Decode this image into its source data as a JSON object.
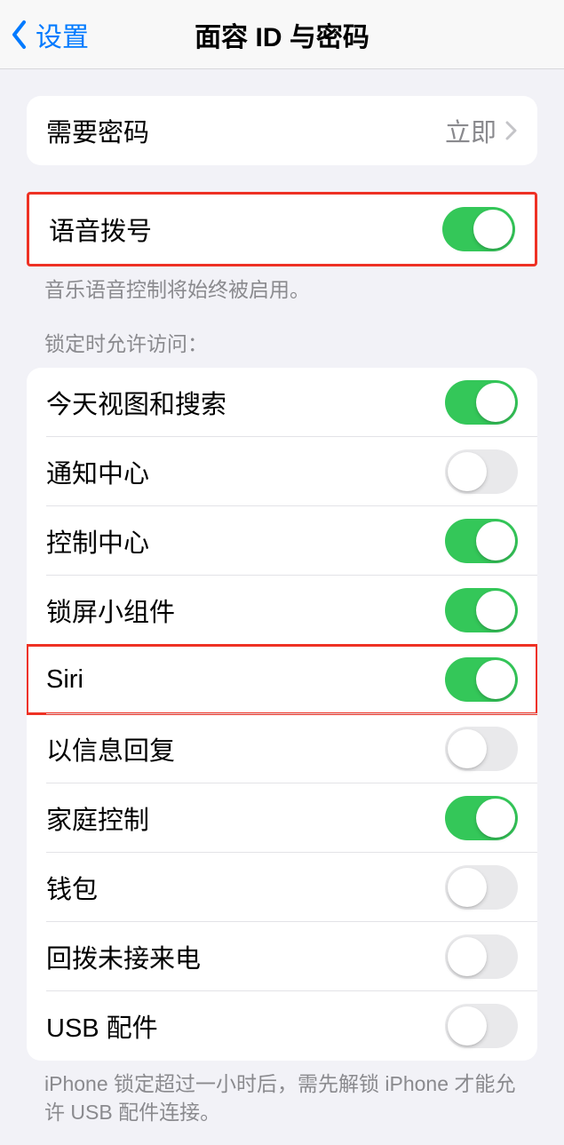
{
  "nav": {
    "back_label": "设置",
    "title": "面容 ID 与密码"
  },
  "require_passcode": {
    "label": "需要密码",
    "value": "立即"
  },
  "voice_dial": {
    "label": "语音拨号",
    "on": true,
    "footer": "音乐语音控制将始终被启用。"
  },
  "lock_access": {
    "header": "锁定时允许访问：",
    "items": [
      {
        "label": "今天视图和搜索",
        "on": true
      },
      {
        "label": "通知中心",
        "on": false
      },
      {
        "label": "控制中心",
        "on": true
      },
      {
        "label": "锁屏小组件",
        "on": true
      },
      {
        "label": "Siri",
        "on": true,
        "highlighted": true
      },
      {
        "label": "以信息回复",
        "on": false
      },
      {
        "label": "家庭控制",
        "on": true
      },
      {
        "label": "钱包",
        "on": false
      },
      {
        "label": "回拨未接来电",
        "on": false
      },
      {
        "label": "USB 配件",
        "on": false
      }
    ],
    "footer": "iPhone 锁定超过一小时后，需先解锁 iPhone 才能允许 USB 配件连接。"
  }
}
